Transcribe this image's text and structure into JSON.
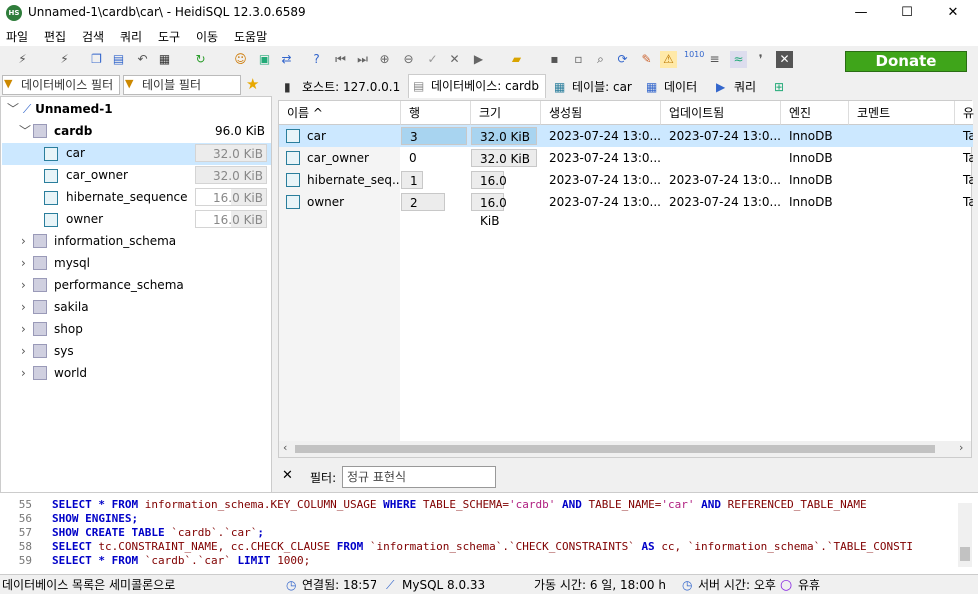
{
  "window": {
    "title": "Unnamed-1\\cardb\\car\\ - HeidiSQL 12.3.0.6589",
    "minimize": "—",
    "maximize": "☐",
    "close": "✕"
  },
  "menu": [
    "파일",
    "편집",
    "검색",
    "쿼리",
    "도구",
    "이동",
    "도움말"
  ],
  "donate": "Donate",
  "filters": {
    "db_placeholder": "데이터베이스 필터",
    "table_placeholder": "테이블 필터"
  },
  "tree": {
    "session": "Unnamed-1",
    "db": {
      "name": "cardb",
      "size": "96.0 KiB"
    },
    "tables": [
      {
        "name": "car",
        "size": "32.0 KiB"
      },
      {
        "name": "car_owner",
        "size": "32.0 KiB"
      },
      {
        "name": "hibernate_sequence",
        "size": "16.0 KiB"
      },
      {
        "name": "owner",
        "size": "16.0 KiB"
      }
    ],
    "databases": [
      "information_schema",
      "mysql",
      "performance_schema",
      "sakila",
      "shop",
      "sys",
      "world"
    ]
  },
  "tabs": [
    "호스트: 127.0.0.1",
    "데이터베이스: cardb",
    "테이블: car",
    "데이터",
    "쿼리"
  ],
  "grid": {
    "columns": [
      "이름 ^",
      "행",
      "크기",
      "생성됨",
      "업데이트됨",
      "엔진",
      "코멘트",
      "유"
    ],
    "rows": [
      [
        "car",
        "3",
        "32.0 KiB",
        "2023-07-24 13:0...",
        "2023-07-24 13:0...",
        "InnoDB",
        "",
        "Ta"
      ],
      [
        "car_owner",
        "0",
        "32.0 KiB",
        "2023-07-24 13:0...",
        "",
        "InnoDB",
        "",
        "Ta"
      ],
      [
        "hibernate_seq...",
        "1",
        "16.0 KiB",
        "2023-07-24 13:0...",
        "2023-07-24 13:0...",
        "InnoDB",
        "",
        "Ta"
      ],
      [
        "owner",
        "2",
        "16.0 KiB",
        "2023-07-24 13:0...",
        "2023-07-24 13:0...",
        "InnoDB",
        "",
        "Ta"
      ]
    ]
  },
  "filter": {
    "close": "✕",
    "label": "필터:",
    "placeholder": "정규 표현식"
  },
  "sql": {
    "lines": [
      {
        "n": "55",
        "parts": [
          [
            "kw",
            "SELECT * FROM "
          ],
          [
            "id",
            "information_schema.KEY_COLUMN_USAGE "
          ],
          [
            "kw",
            "WHERE "
          ],
          [
            "id",
            "  TABLE_SCHEMA="
          ],
          [
            "str",
            "'cardb'"
          ],
          [
            "kw",
            "   AND "
          ],
          [
            "id",
            "TABLE_NAME="
          ],
          [
            "str",
            "'car'"
          ],
          [
            "kw",
            "   AND "
          ],
          [
            "id",
            "REFERENCED_TABLE_NAME"
          ]
        ]
      },
      {
        "n": "56",
        "parts": [
          [
            "kw",
            "SHOW ENGINES;"
          ]
        ]
      },
      {
        "n": "57",
        "parts": [
          [
            "kw",
            "SHOW CREATE TABLE "
          ],
          [
            "id",
            "`cardb`.`car`"
          ],
          [
            "kw",
            ";"
          ]
        ]
      },
      {
        "n": "58",
        "parts": [
          [
            "kw",
            "SELECT "
          ],
          [
            "id",
            "tc.CONSTRAINT_NAME, cc.CHECK_CLAUSE "
          ],
          [
            "kw",
            "FROM "
          ],
          [
            "id",
            "`information_schema`.`CHECK_CONSTRAINTS` "
          ],
          [
            "kw",
            "AS "
          ],
          [
            "id",
            "cc, `information_schema`.`TABLE_CONSTI"
          ]
        ]
      },
      {
        "n": "59",
        "parts": [
          [
            "kw",
            "SELECT * FROM "
          ],
          [
            "id",
            "`cardb`.`car` "
          ],
          [
            "kw",
            "LIMIT "
          ],
          [
            "id",
            "1000;"
          ]
        ]
      }
    ]
  },
  "status": {
    "msg": "데이터베이스 목록은 세미콜론으로",
    "connected": "연결됨: 18:57",
    "server": "MySQL 8.0.33",
    "uptime": "가동 시간: 6 일, 18:00 h",
    "servertime": "서버 시간: 오후",
    "idle": "유휴"
  },
  "colors": {
    "selection": "#cce8ff",
    "donate": "#3fa51a"
  }
}
